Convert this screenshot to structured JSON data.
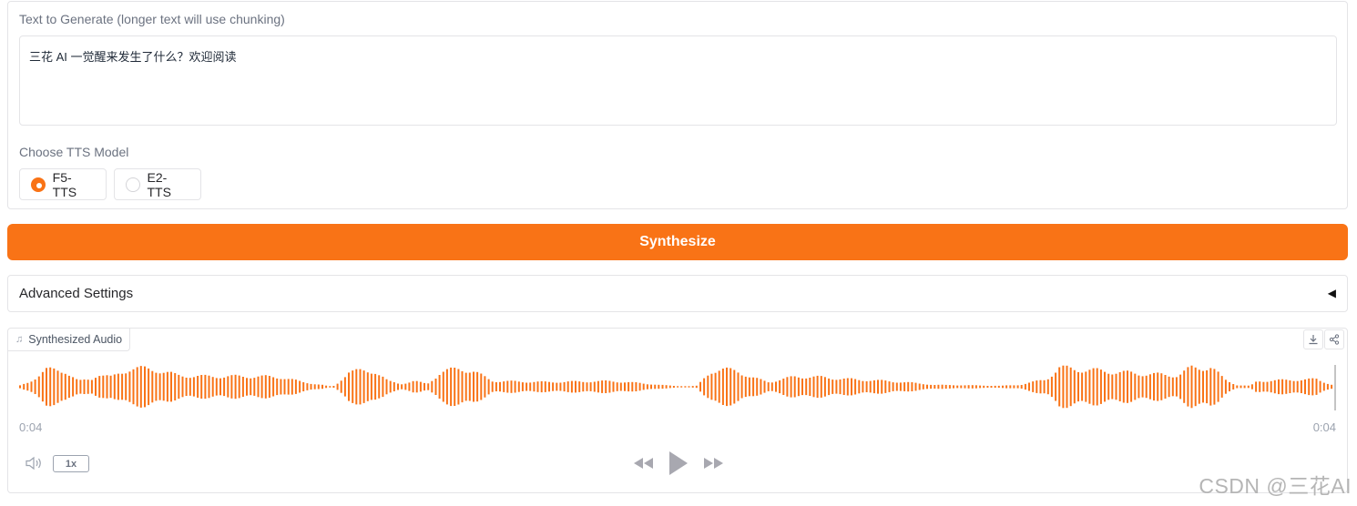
{
  "input": {
    "text_label": "Text to Generate (longer text will use chunking)",
    "text_value": "三花 AI 一觉醒来发生了什么？欢迎阅读",
    "model_label": "Choose TTS Model",
    "models": [
      {
        "label": "F5-TTS",
        "selected": true
      },
      {
        "label": "E2-TTS",
        "selected": false
      }
    ]
  },
  "synthesize_label": "Synthesize",
  "advanced": {
    "label": "Advanced Settings",
    "toggle_icon": "◀"
  },
  "audio": {
    "tab_label": "Synthesized Audio",
    "tab_icon": "music-note-icon",
    "time_current": "0:04",
    "time_total": "0:04",
    "speed_label": "1x",
    "accent_color": "#f97316"
  },
  "watermark": "CSDN @三花AI"
}
